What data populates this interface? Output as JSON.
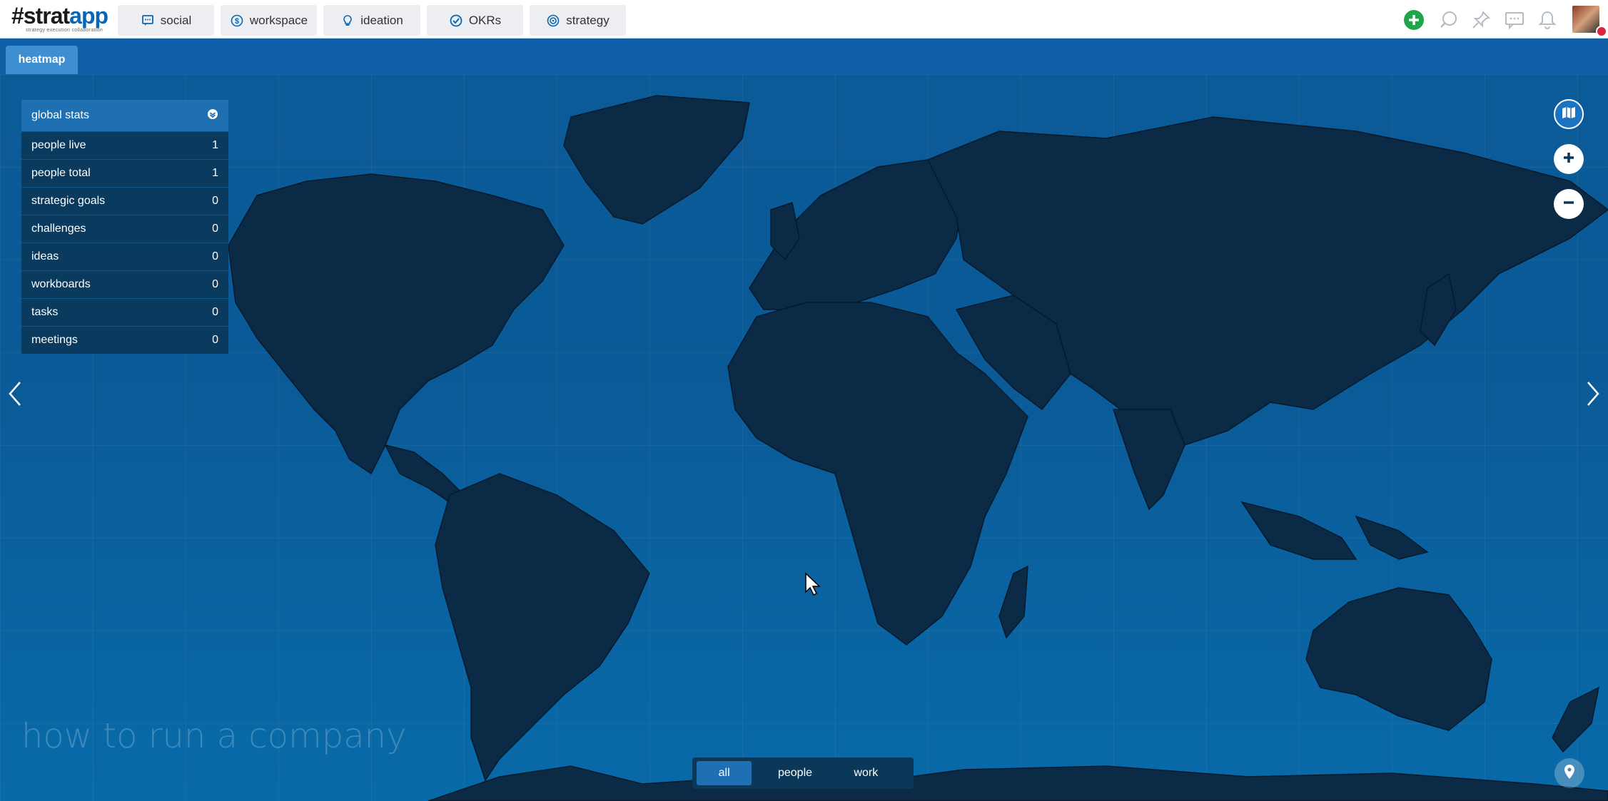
{
  "app": {
    "logo_prefix": "#strat",
    "logo_suffix": "app",
    "tagline": "strategy execution collaboration"
  },
  "nav": {
    "tabs": [
      {
        "label": "social",
        "icon": "chat-icon"
      },
      {
        "label": "workspace",
        "icon": "dollar-icon"
      },
      {
        "label": "ideation",
        "icon": "lightbulb-icon"
      },
      {
        "label": "OKRs",
        "icon": "check-circle-icon"
      },
      {
        "label": "strategy",
        "icon": "target-icon"
      }
    ]
  },
  "toolbar_icons": [
    "add-icon",
    "search-icon",
    "pin-icon",
    "messages-icon",
    "bell-icon",
    "avatar"
  ],
  "subnav": {
    "active_tab": "heatmap"
  },
  "stats": {
    "header": "global stats",
    "rows": [
      {
        "label": "people live",
        "value": "1"
      },
      {
        "label": "people total",
        "value": "1"
      },
      {
        "label": "strategic goals",
        "value": "0"
      },
      {
        "label": "challenges",
        "value": "0"
      },
      {
        "label": "ideas",
        "value": "0"
      },
      {
        "label": "workboards",
        "value": "0"
      },
      {
        "label": "tasks",
        "value": "0"
      },
      {
        "label": "meetings",
        "value": "0"
      }
    ]
  },
  "watermark": "how to run a company",
  "filter": {
    "options": [
      "all",
      "people",
      "work"
    ],
    "selected": "all"
  },
  "colors": {
    "brand": "#0a66b2",
    "subbar": "#0e5fa6",
    "ocean": "#0a5a97",
    "land": "#0b2a45",
    "add_green": "#1fa64a"
  }
}
